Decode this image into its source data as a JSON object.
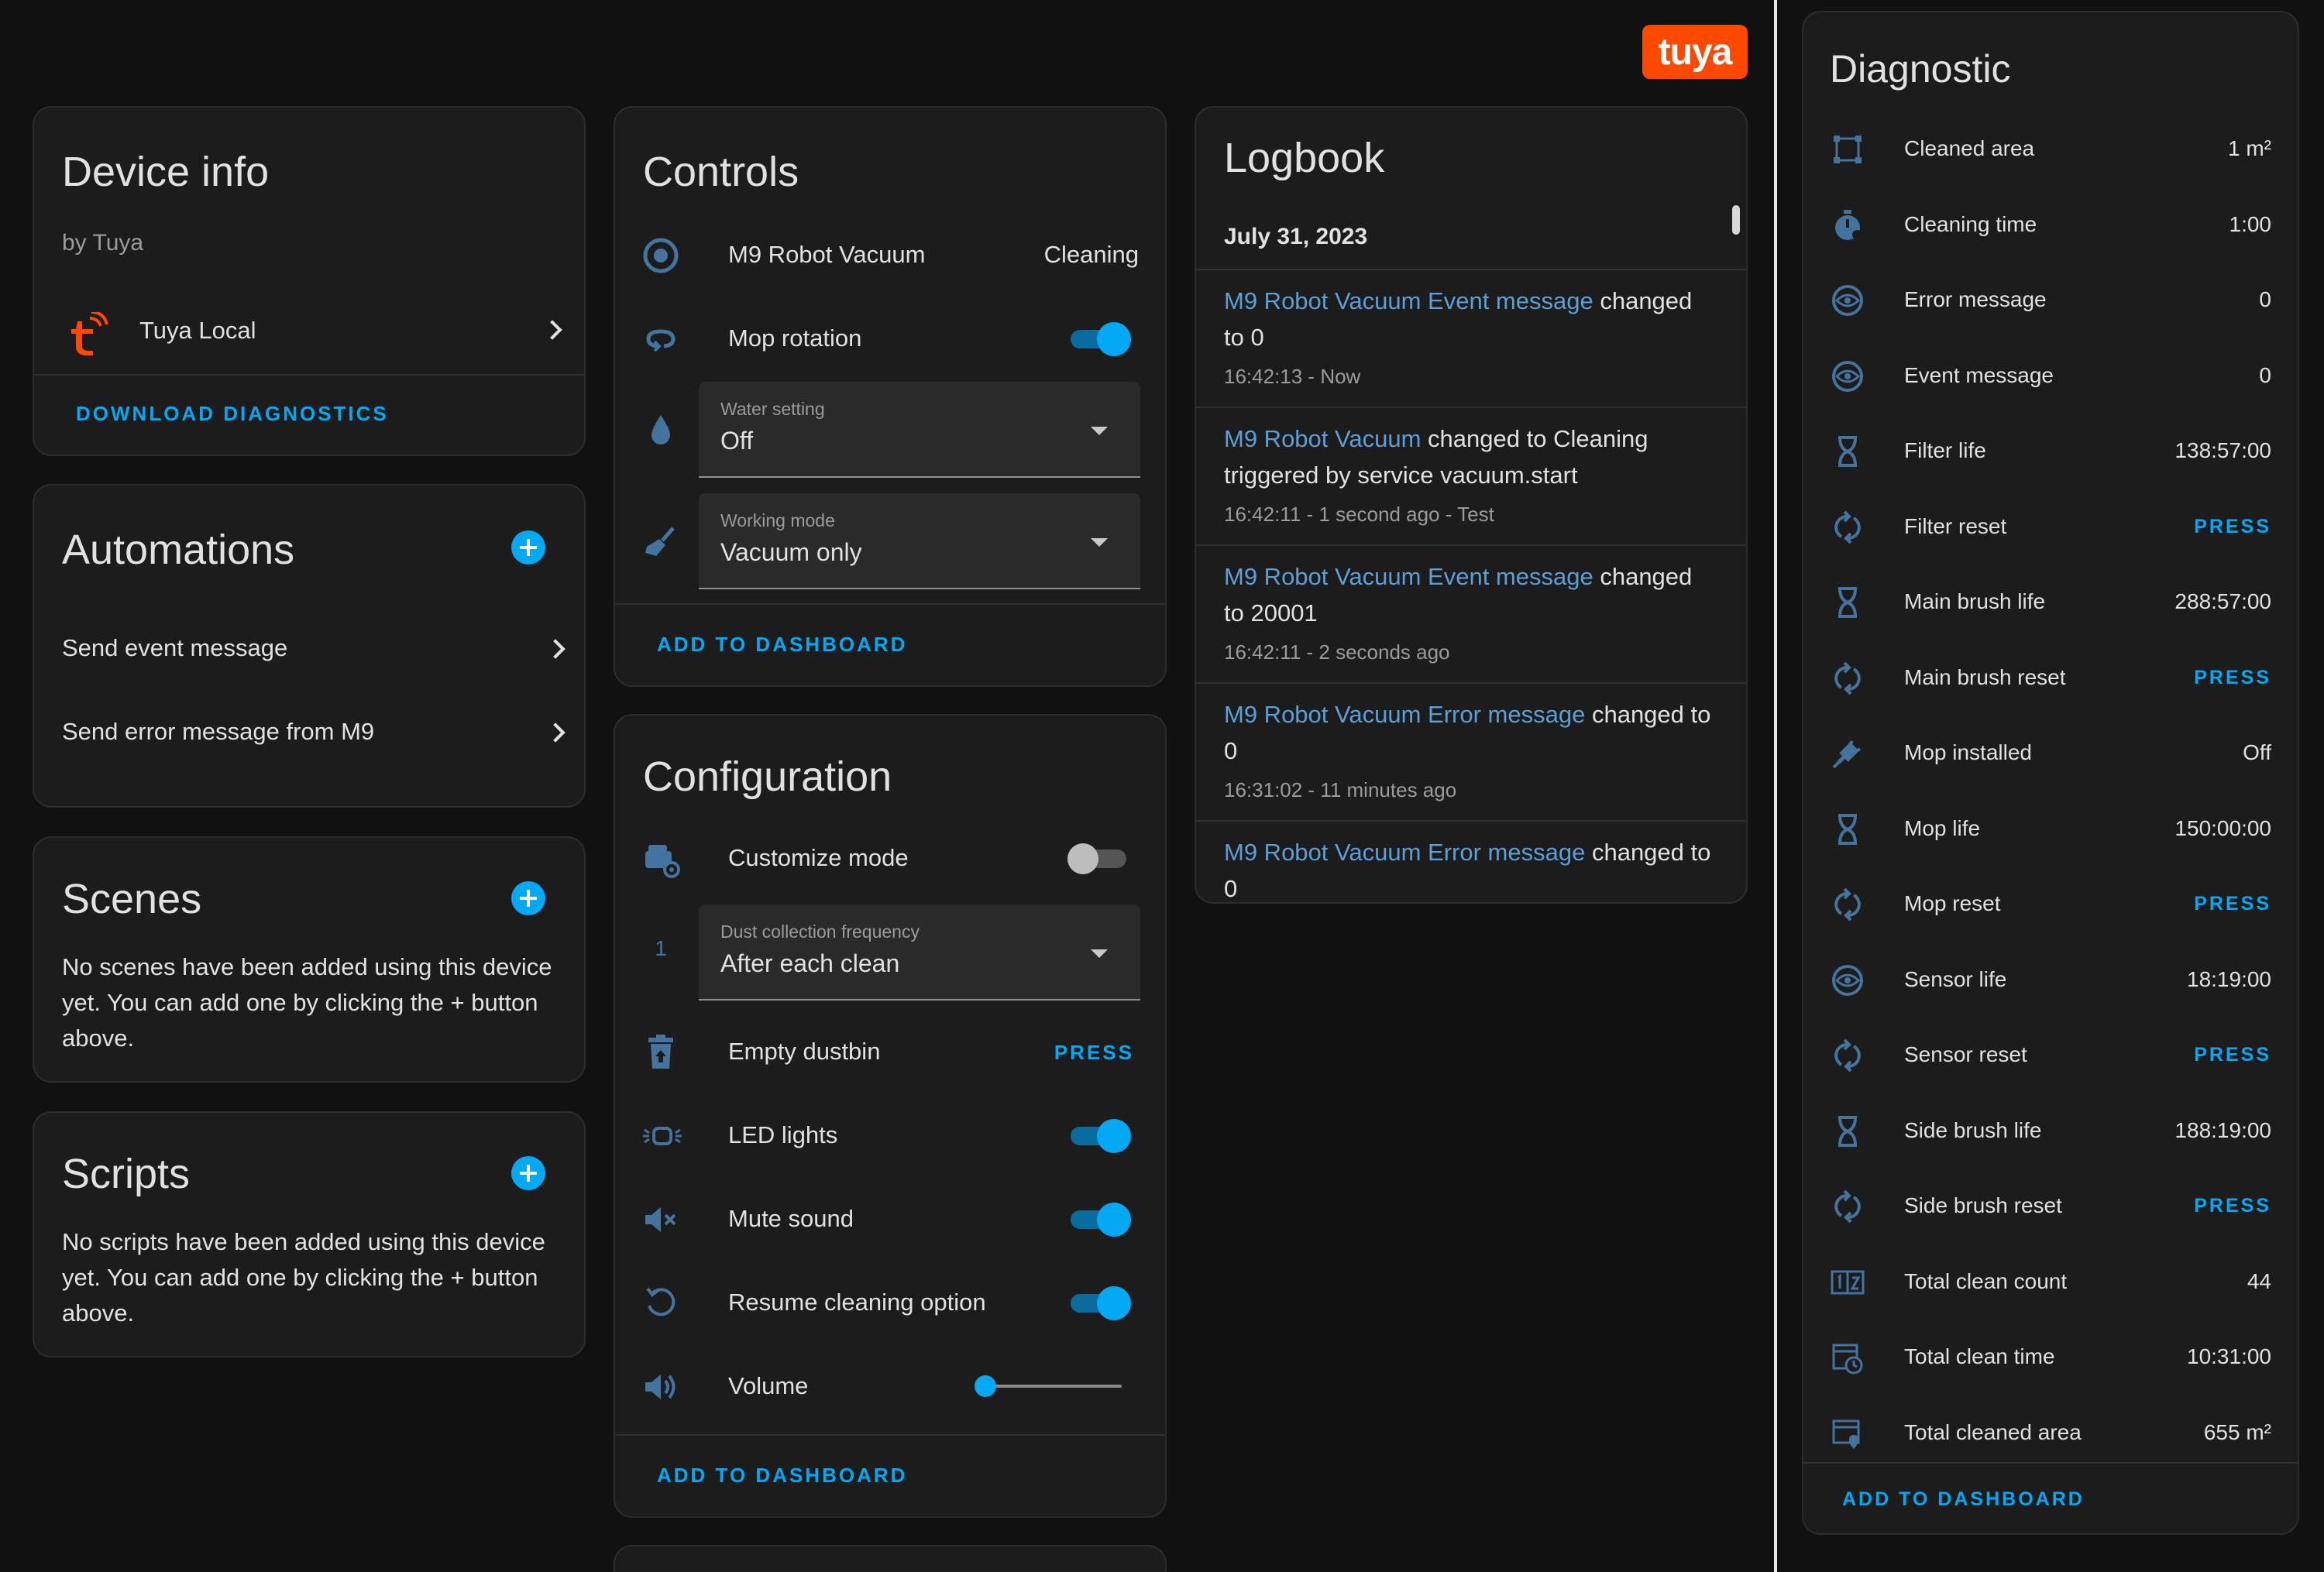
{
  "brand": {
    "logo_text": "tuya",
    "accent": "#03a9f4",
    "icon_color": "#44739e",
    "logo_color": "#ff4800"
  },
  "device_info": {
    "title": "Device info",
    "by": "by Tuya",
    "integration": "Tuya Local",
    "download_label": "DOWNLOAD DIAGNOSTICS"
  },
  "automations": {
    "title": "Automations",
    "items": [
      "Send event message",
      "Send error message from M9"
    ]
  },
  "scenes": {
    "title": "Scenes",
    "empty_text": "No scenes have been added using this device yet. You can add one by clicking the + button above."
  },
  "scripts": {
    "title": "Scripts",
    "empty_text": "No scripts have been added using this device yet. You can add one by clicking the + button above."
  },
  "controls": {
    "title": "Controls",
    "vacuum_name": "M9 Robot Vacuum",
    "vacuum_state": "Cleaning",
    "mop_rotation": "Mop rotation",
    "mop_rotation_on": true,
    "water_setting": {
      "label": "Water setting",
      "value": "Off"
    },
    "working_mode": {
      "label": "Working mode",
      "value": "Vacuum only"
    },
    "add_label": "ADD TO DASHBOARD"
  },
  "configuration": {
    "title": "Configuration",
    "customize_mode": "Customize mode",
    "customize_mode_on": false,
    "dust_frequency": {
      "icon_text": "1",
      "label": "Dust collection frequency",
      "value": "After each clean"
    },
    "empty_dustbin": "Empty dustbin",
    "press_label": "PRESS",
    "led_lights": "LED lights",
    "led_on": true,
    "mute_sound": "Mute sound",
    "mute_on": true,
    "resume_option": "Resume cleaning option",
    "resume_on": true,
    "volume": "Volume",
    "volume_level": 0,
    "add_label": "ADD TO DASHBOARD"
  },
  "logbook": {
    "title": "Logbook",
    "date": "July 31, 2023",
    "entries": [
      {
        "entity": "M9 Robot Vacuum Event message",
        "text": " changed to 0",
        "meta": "16:42:13 - Now"
      },
      {
        "entity": "M9 Robot Vacuum",
        "text": " changed to Cleaning triggered by service vacuum.start",
        "meta": "16:42:11 - 1 second ago - Test"
      },
      {
        "entity": "M9 Robot Vacuum Event message",
        "text": " changed to 20001",
        "meta": "16:42:11 - 2 seconds ago"
      },
      {
        "entity": "M9 Robot Vacuum Error message",
        "text": " changed to 0",
        "meta": "16:31:02 - 11 minutes ago"
      },
      {
        "entity": "M9 Robot Vacuum Error message",
        "text": " changed to 0",
        "meta": ""
      }
    ]
  },
  "diagnostic": {
    "title": "Diagnostic",
    "add_label": "ADD TO DASHBOARD",
    "rows": [
      {
        "label": "Cleaned area",
        "value": "1 m²",
        "icon": "area-icon"
      },
      {
        "label": "Cleaning time",
        "value": "1:00",
        "icon": "timer-icon"
      },
      {
        "label": "Error message",
        "value": "0",
        "icon": "eye-icon"
      },
      {
        "label": "Event message",
        "value": "0",
        "icon": "eye-icon"
      },
      {
        "label": "Filter life",
        "value": "138:57:00",
        "icon": "hourglass-icon"
      },
      {
        "label": "Filter reset",
        "value": "PRESS",
        "icon": "refresh-icon"
      },
      {
        "label": "Main brush life",
        "value": "288:57:00",
        "icon": "hourglass-icon"
      },
      {
        "label": "Main brush reset",
        "value": "PRESS",
        "icon": "refresh-icon"
      },
      {
        "label": "Mop installed",
        "value": "Off",
        "icon": "plug-icon"
      },
      {
        "label": "Mop life",
        "value": "150:00:00",
        "icon": "hourglass-icon"
      },
      {
        "label": "Mop reset",
        "value": "PRESS",
        "icon": "refresh-icon"
      },
      {
        "label": "Sensor life",
        "value": "18:19:00",
        "icon": "eye-icon"
      },
      {
        "label": "Sensor reset",
        "value": "PRESS",
        "icon": "refresh-icon"
      },
      {
        "label": "Side brush life",
        "value": "188:19:00",
        "icon": "hourglass-icon"
      },
      {
        "label": "Side brush reset",
        "value": "PRESS",
        "icon": "refresh-icon"
      },
      {
        "label": "Total clean count",
        "value": "44",
        "icon": "counter-icon"
      },
      {
        "label": "Total clean time",
        "value": "10:31:00",
        "icon": "history-icon"
      },
      {
        "label": "Total cleaned area",
        "value": "655 m²",
        "icon": "area-total-icon"
      }
    ]
  }
}
